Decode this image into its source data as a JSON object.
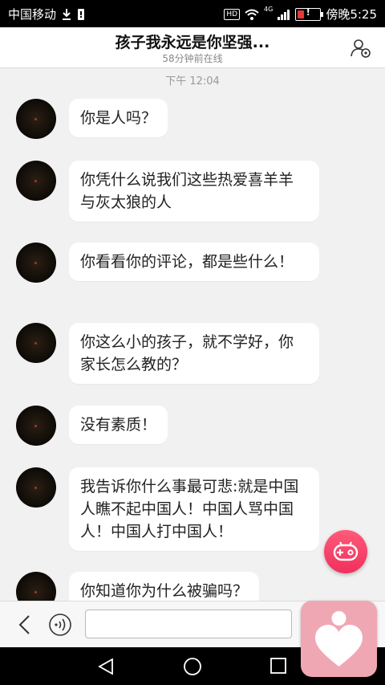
{
  "status_bar": {
    "carrier": "中国移动",
    "hd_badge": "HD",
    "network": "4G",
    "time_label": "傍晚5:25"
  },
  "header": {
    "title": "孩子我永远是你坚强...",
    "subtitle": "58分钟前在线"
  },
  "timestamp": "下午 12:04",
  "messages": [
    {
      "text": "你是人吗？"
    },
    {
      "text": "你凭什么说我们这些热爱喜羊羊与灰太狼的人"
    },
    {
      "text": "你看看你的评论，都是些什么！"
    },
    {
      "text": "你这么小的孩子，就不学好，你家长怎么教的？"
    },
    {
      "text": "没有素质！"
    },
    {
      "text": "我告诉你什么事最可悲:就是中国人瞧不起中国人！中国人骂中国人！中国人打中国人！"
    },
    {
      "text": "你知道你为什么被骗吗？"
    }
  ],
  "input": {
    "value": "",
    "placeholder": ""
  },
  "colors": {
    "background": "#f1f1f1",
    "fab": "#f0305d",
    "logo": "#f0a7b4",
    "battery": "#e53935"
  }
}
